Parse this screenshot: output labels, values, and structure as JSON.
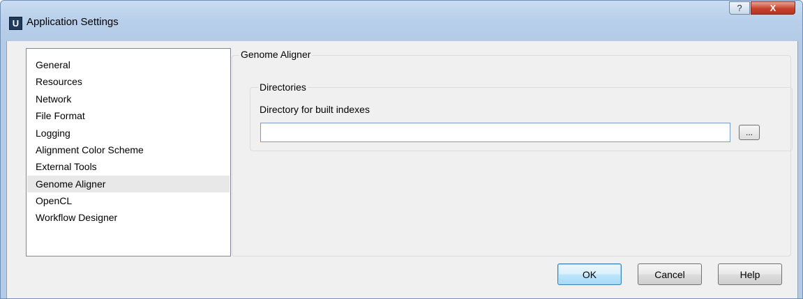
{
  "window": {
    "title": "Application Settings",
    "app_icon_letter": "U",
    "help_button_label": "?",
    "close_button_label": "X"
  },
  "sidebar": {
    "items": [
      {
        "label": "General",
        "selected": false
      },
      {
        "label": "Resources",
        "selected": false
      },
      {
        "label": "Network",
        "selected": false
      },
      {
        "label": "File Format",
        "selected": false
      },
      {
        "label": "Logging",
        "selected": false
      },
      {
        "label": "Alignment Color Scheme",
        "selected": false
      },
      {
        "label": "External Tools",
        "selected": false
      },
      {
        "label": "Genome Aligner",
        "selected": true
      },
      {
        "label": "OpenCL",
        "selected": false
      },
      {
        "label": "Workflow Designer",
        "selected": false
      }
    ]
  },
  "panel": {
    "title": "Genome Aligner",
    "directories_group": {
      "title": "Directories",
      "index_dir_label": "Directory for built indexes",
      "index_dir_value": "",
      "browse_label": "..."
    }
  },
  "footer": {
    "ok_label": "OK",
    "cancel_label": "Cancel",
    "help_label": "Help"
  }
}
